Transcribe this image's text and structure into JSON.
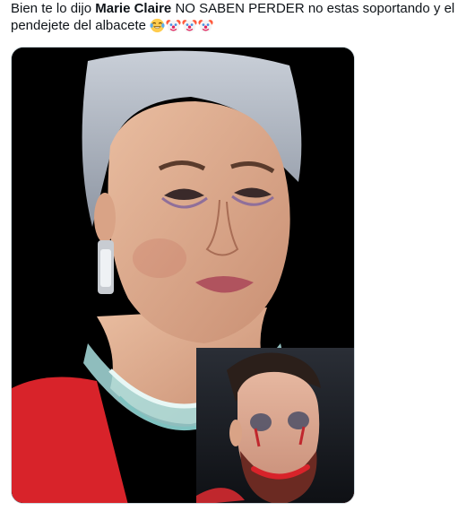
{
  "post": {
    "text_part1": "Bien te lo dijo ",
    "text_bold": "Marie Claire",
    "text_part2": " NO SABEN PERDER  no estas soportando y el pendejete del albacete ",
    "emojis": [
      "face-with-tears-of-joy-icon",
      "clown-face-icon",
      "clown-face-icon",
      "clown-face-icon"
    ]
  },
  "media": {
    "description_icon": "meme-photo-image"
  },
  "colors": {
    "text": "#0f1419",
    "background": "#ffffff",
    "media_border": "#cfd9de",
    "dress_red": "#d8232a"
  }
}
